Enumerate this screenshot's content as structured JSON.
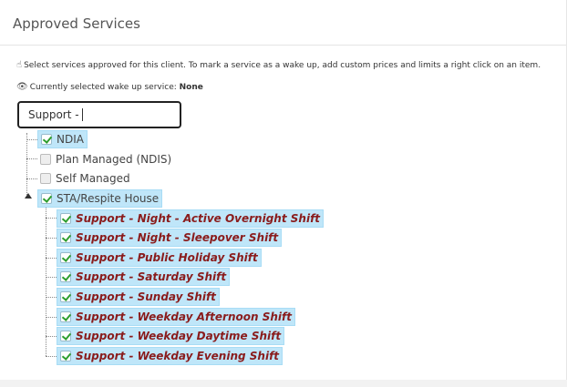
{
  "panel": {
    "title": "Approved Services"
  },
  "hint": {
    "icon": "pointer-hand-icon",
    "text": "Select services approved for this client. To mark a service as a wake up, add custom prices and limits a right click on an item."
  },
  "wake_up": {
    "icon": "eye-icon",
    "prefix": "Currently selected wake up service: ",
    "value": "None"
  },
  "search": {
    "value": "Support -"
  },
  "tree": {
    "items": [
      {
        "label": "NDIA",
        "checked": true,
        "selected": true
      },
      {
        "label": "Plan Managed (NDIS)",
        "checked": false,
        "selected": false
      },
      {
        "label": "Self Managed",
        "checked": false,
        "selected": false
      },
      {
        "label": "STA/Respite House",
        "checked": true,
        "selected": true,
        "expanded": true
      }
    ],
    "children": [
      {
        "label": "Support - Night - Active Overnight Shift",
        "checked": true
      },
      {
        "label": "Support - Night - Sleepover Shift",
        "checked": true
      },
      {
        "label": "Support - Public Holiday Shift",
        "checked": true
      },
      {
        "label": "Support - Saturday Shift",
        "checked": true
      },
      {
        "label": "Support - Sunday Shift",
        "checked": true
      },
      {
        "label": "Support - Weekday Afternoon Shift",
        "checked": true
      },
      {
        "label": "Support - Weekday Daytime Shift",
        "checked": true
      },
      {
        "label": "Support - Weekday Evening Shift",
        "checked": true
      }
    ]
  },
  "colors": {
    "selection_bg": "#bfe6f9",
    "child_label": "#8a1c1c",
    "check": "#2e9e2e"
  }
}
